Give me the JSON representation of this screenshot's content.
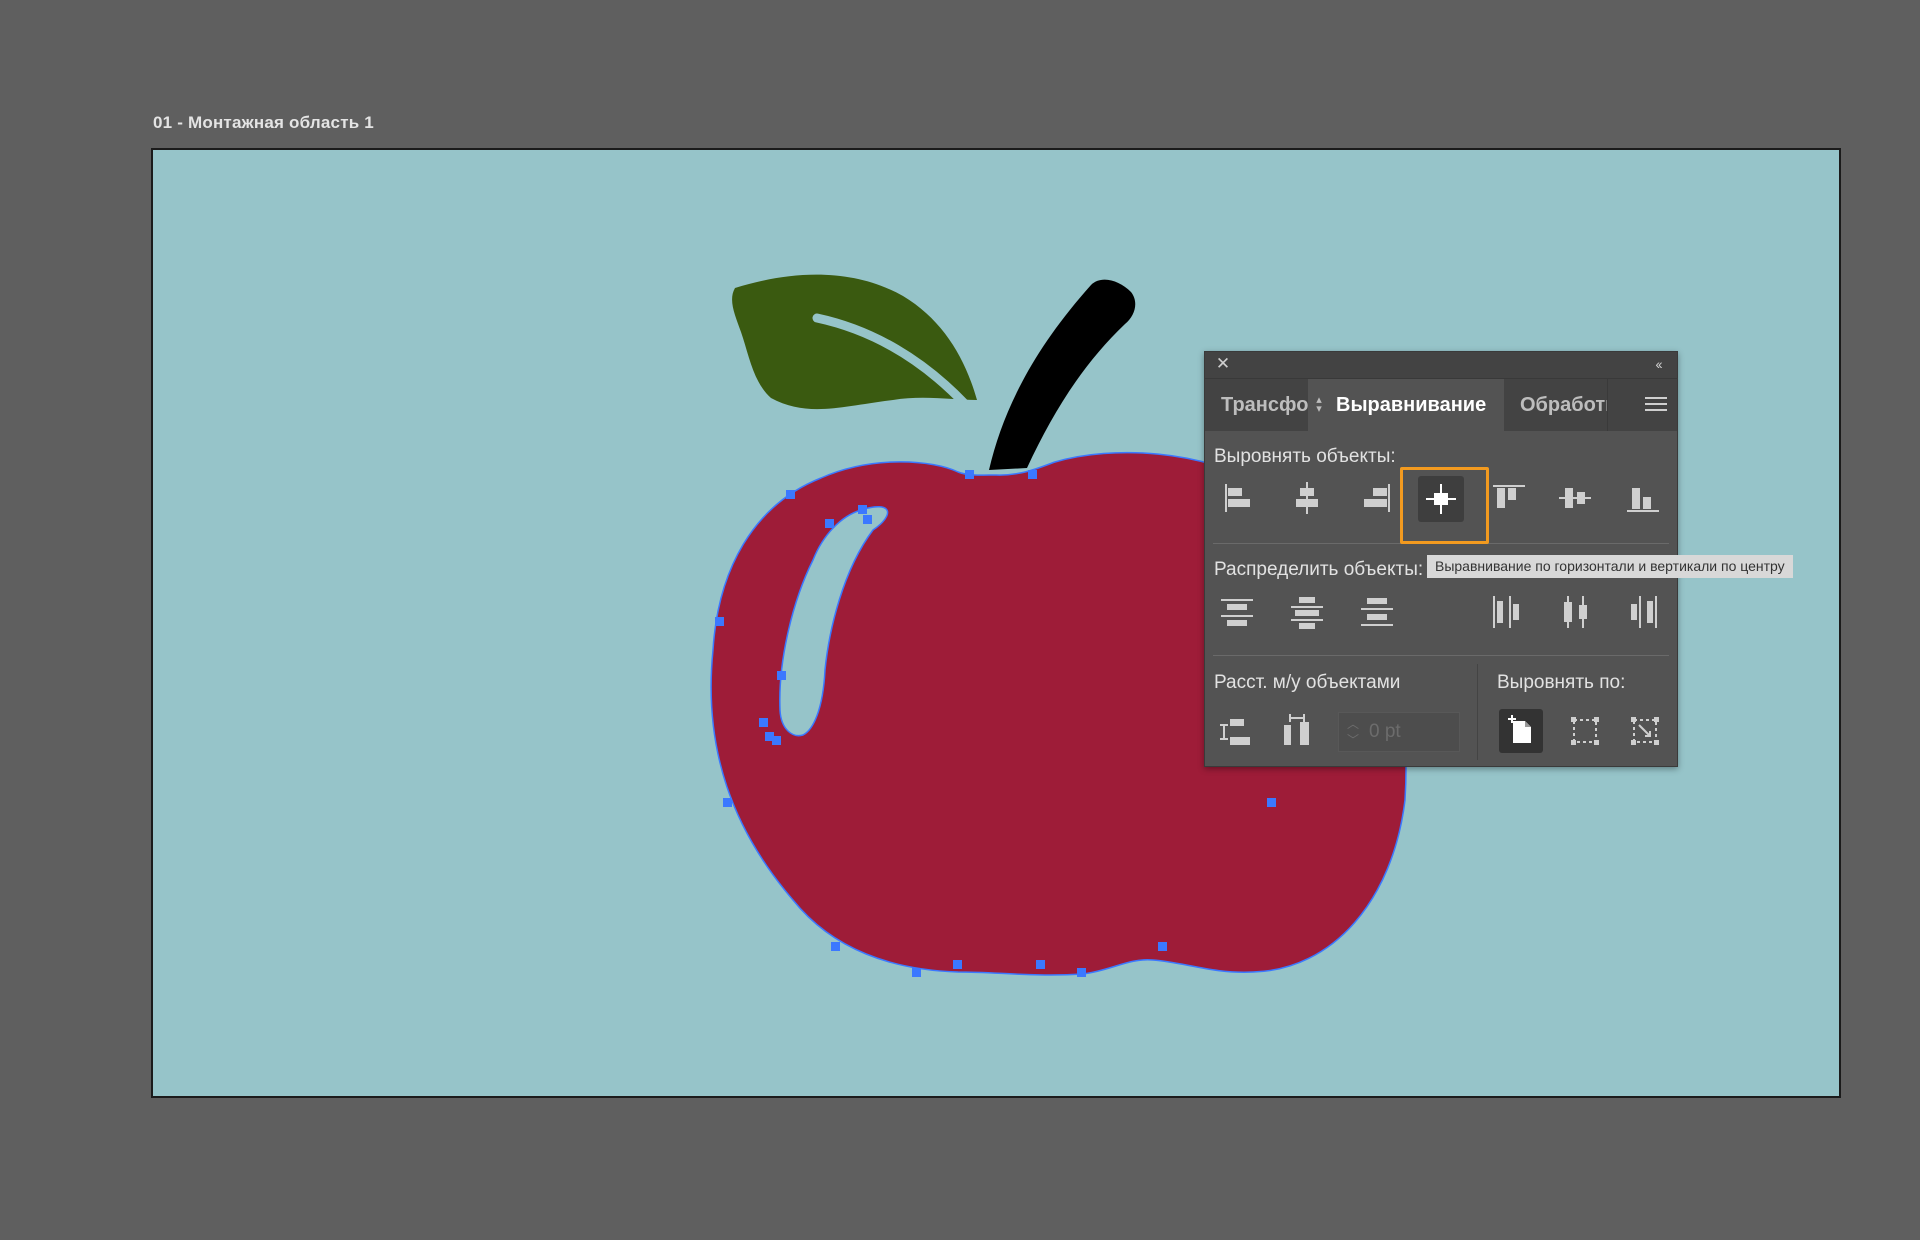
{
  "artboard": {
    "label": "01 - Монтажная область 1",
    "background_color": "#96c4c9"
  },
  "illustration": {
    "apple_color": "#9e1c38",
    "leaf_color": "#3a5a10",
    "stem_color": "#000000",
    "selection_color": "#3b78ff"
  },
  "panel": {
    "close_icon": "close-icon",
    "collapse_icon": "double-chevron-left-icon",
    "tabs": [
      {
        "label": "Трансформирование",
        "active": false
      },
      {
        "label": "Выравнивание",
        "active": true
      },
      {
        "label": "Обработка контуров",
        "active": false
      }
    ],
    "menu_icon": "hamburger-menu-icon",
    "align_objects": {
      "title": "Выровнять объекты:",
      "buttons": [
        "align-left-icon",
        "align-horizontal-center-icon",
        "align-right-icon",
        "align-center-both-icon",
        "align-top-icon",
        "align-vertical-center-icon",
        "align-bottom-icon"
      ]
    },
    "distribute_objects": {
      "title": "Распределить объекты:",
      "buttons": [
        "distribute-top-icon",
        "distribute-vertical-center-icon",
        "distribute-bottom-icon",
        "distribute-left-icon",
        "distribute-horizontal-center-icon",
        "distribute-right-icon"
      ]
    },
    "distribute_spacing": {
      "title": "Расст. м/у объектами",
      "value_placeholder": "0 pt"
    },
    "align_to": {
      "title": "Выровнять по:",
      "selected": "align-to-artboard"
    }
  },
  "tooltip": {
    "text": "Выравнивание по горизонтали и вертикали по центру"
  },
  "highlight_color": "#f29a1f"
}
